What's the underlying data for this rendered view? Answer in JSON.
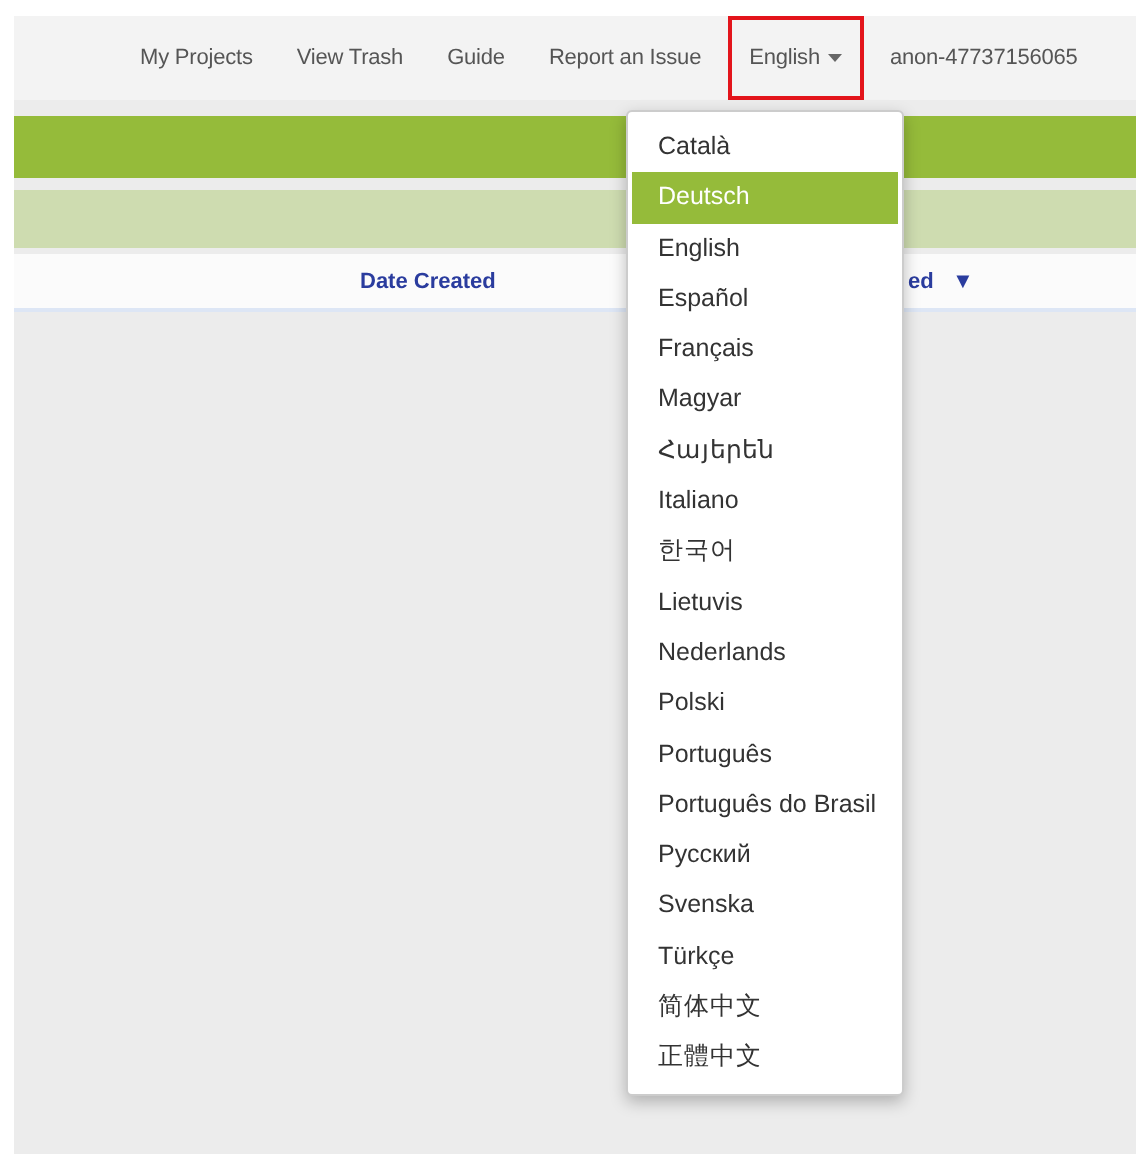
{
  "nav": {
    "items": [
      {
        "label": "My Projects",
        "kind": "link",
        "highlighted": false
      },
      {
        "label": "View Trash",
        "kind": "link",
        "highlighted": false
      },
      {
        "label": "Guide",
        "kind": "link",
        "highlighted": false
      },
      {
        "label": "Report an Issue",
        "kind": "link",
        "highlighted": false
      },
      {
        "label": "English",
        "kind": "dropdown",
        "highlighted": true
      },
      {
        "label": "anon-47737156065",
        "kind": "link",
        "highlighted": false
      }
    ]
  },
  "table": {
    "columns": [
      {
        "label": "Date Created"
      },
      {
        "label": "ed",
        "sort": "▼"
      }
    ]
  },
  "language_menu": {
    "items": [
      {
        "label": "Català",
        "selected": false
      },
      {
        "label": "Deutsch",
        "selected": true
      },
      {
        "label": "English",
        "selected": false
      },
      {
        "label": "Español",
        "selected": false
      },
      {
        "label": "Français",
        "selected": false
      },
      {
        "label": "Magyar",
        "selected": false
      },
      {
        "label": "Հայերեն",
        "selected": false
      },
      {
        "label": "Italiano",
        "selected": false
      },
      {
        "label": "한국어",
        "selected": false
      },
      {
        "label": "Lietuvis",
        "selected": false
      },
      {
        "label": "Nederlands",
        "selected": false
      },
      {
        "label": "Polski",
        "selected": false
      },
      {
        "label": "Português",
        "selected": false
      },
      {
        "label": "Português do Brasil",
        "selected": false
      },
      {
        "label": "Русский",
        "selected": false
      },
      {
        "label": "Svenska",
        "selected": false
      },
      {
        "label": "Türkçe",
        "selected": false
      },
      {
        "label": "简体中文",
        "selected": false
      },
      {
        "label": "正體中文",
        "selected": false
      }
    ]
  }
}
